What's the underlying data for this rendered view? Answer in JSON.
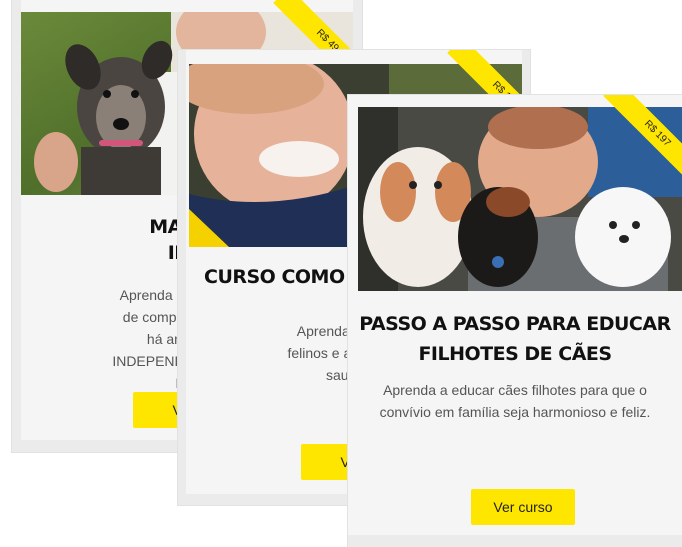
{
  "card1": {
    "price": "R$ 49",
    "title_line1": "MAI – ADES",
    "title_line2": "INTEL",
    "desc_line1": "Aprenda a corrigir ate",
    "desc_line2": "de comportamento q",
    "desc_line3": "há anos no s",
    "desc_line4": "INDEPENDENTEMENT",
    "desc_line5": "IDA",
    "button": "Ver"
  },
  "card2": {
    "price": "R$ 1",
    "title": "CURSO COMO C",
    "desc_line1": "Aprenda sobre o c",
    "desc_line2": "felinos e a como man",
    "desc_line3": "saudável",
    "button": "Ver"
  },
  "card3": {
    "price": "R$ 197",
    "title_line1": "PASSO A PASSO PARA EDUCAR",
    "title_line2": "FILHOTES DE CÃES",
    "desc_line1": "Aprenda a educar cães filhotes para que o",
    "desc_line2": "convívio em família seja harmonioso e feliz.",
    "button": "Ver curso"
  },
  "colors": {
    "accent": "#ffe600",
    "card_bg": "#f5f5f5",
    "title": "#111111",
    "text": "#555555"
  }
}
